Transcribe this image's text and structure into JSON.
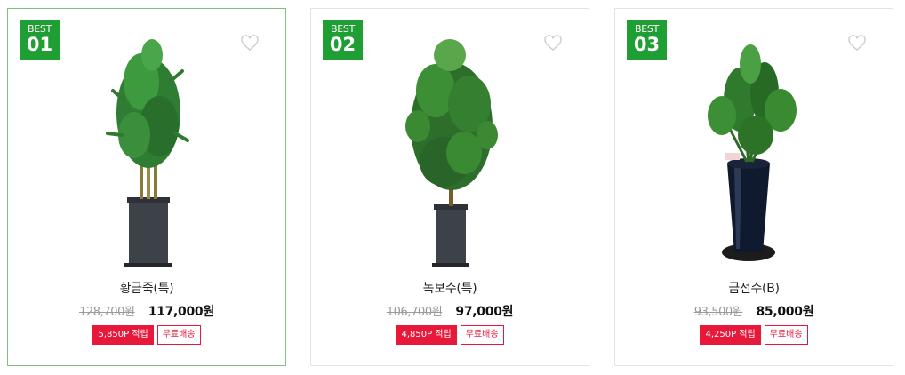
{
  "products": [
    {
      "badge_label": "BEST",
      "rank": "01",
      "name": "황금죽(특)",
      "original_price": "128,700원",
      "sale_price": "117,000원",
      "points": "5,850P 적립",
      "shipping": "무료배송",
      "active": true
    },
    {
      "badge_label": "BEST",
      "rank": "02",
      "name": "녹보수(특)",
      "original_price": "106,700원",
      "sale_price": "97,000원",
      "points": "4,850P 적립",
      "shipping": "무료배송",
      "active": false
    },
    {
      "badge_label": "BEST",
      "rank": "03",
      "name": "금전수(B)",
      "original_price": "93,500원",
      "sale_price": "85,000원",
      "points": "4,250P 적립",
      "shipping": "무료배송",
      "active": false
    }
  ],
  "colors": {
    "badge_green": "#1f9e33",
    "active_border": "#7dc37e",
    "point_red": "#e8183a"
  },
  "icons": [
    "heart-outline-icon"
  ]
}
